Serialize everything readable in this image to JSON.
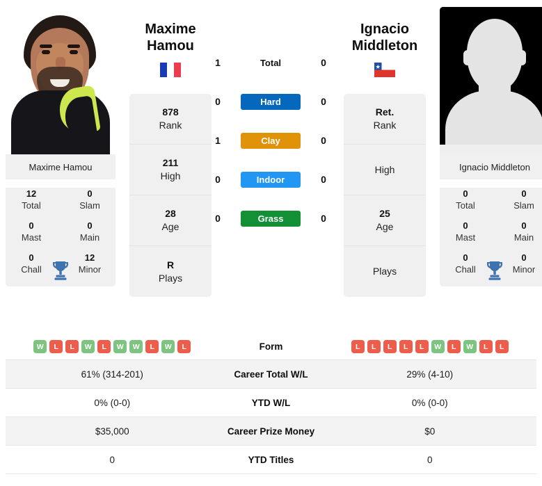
{
  "players": {
    "left": {
      "name_line1": "Maxime",
      "name_line2": "Hamou",
      "full_name": "Maxime Hamou",
      "flag": "france-flag",
      "photo": "player-photo",
      "rank": {
        "value": "878",
        "label": "Rank"
      },
      "high": {
        "value": "211",
        "label": "High"
      },
      "age": {
        "value": "28",
        "label": "Age"
      },
      "plays": {
        "value": "R",
        "label": "Plays"
      },
      "titles": {
        "total": {
          "value": "12",
          "label": "Total"
        },
        "slam": {
          "value": "0",
          "label": "Slam"
        },
        "mast": {
          "value": "0",
          "label": "Mast"
        },
        "main": {
          "value": "0",
          "label": "Main"
        },
        "chall": {
          "value": "0",
          "label": "Chall"
        },
        "minor": {
          "value": "12",
          "label": "Minor"
        }
      },
      "form": [
        "W",
        "L",
        "L",
        "W",
        "L",
        "W",
        "W",
        "L",
        "W",
        "L"
      ],
      "career_total_wl": "61% (314-201)",
      "ytd_wl": "0% (0-0)",
      "career_prize_money": "$35,000",
      "ytd_titles": "0",
      "surface_wins": {
        "total": "1",
        "hard": "0",
        "clay": "1",
        "indoor": "0",
        "grass": "0"
      }
    },
    "right": {
      "name_line1": "Ignacio",
      "name_line2": "Middleton",
      "full_name": "Ignacio Middleton",
      "flag": "chile-flag",
      "photo": "player-photo-placeholder",
      "rank": {
        "value": "Ret.",
        "label": "Rank"
      },
      "high": {
        "value": "",
        "label": "High"
      },
      "age": {
        "value": "25",
        "label": "Age"
      },
      "plays": {
        "value": "",
        "label": "Plays"
      },
      "titles": {
        "total": {
          "value": "0",
          "label": "Total"
        },
        "slam": {
          "value": "0",
          "label": "Slam"
        },
        "mast": {
          "value": "0",
          "label": "Mast"
        },
        "main": {
          "value": "0",
          "label": "Main"
        },
        "chall": {
          "value": "0",
          "label": "Chall"
        },
        "minor": {
          "value": "0",
          "label": "Minor"
        }
      },
      "form": [
        "L",
        "L",
        "L",
        "L",
        "L",
        "W",
        "L",
        "W",
        "L",
        "L"
      ],
      "career_total_wl": "29% (4-10)",
      "ytd_wl": "0% (0-0)",
      "career_prize_money": "$0",
      "ytd_titles": "0",
      "surface_wins": {
        "total": "0",
        "hard": "0",
        "clay": "0",
        "indoor": "0",
        "grass": "0"
      }
    }
  },
  "surfaces": [
    {
      "key": "total",
      "label": "Total",
      "color": "transparent",
      "style": "plain"
    },
    {
      "key": "hard",
      "label": "Hard",
      "color": "#0668bd",
      "style": "pill"
    },
    {
      "key": "clay",
      "label": "Clay",
      "color": "#e09309",
      "style": "pill"
    },
    {
      "key": "indoor",
      "label": "Indoor",
      "color": "#2196f3",
      "style": "pill"
    },
    {
      "key": "grass",
      "label": "Grass",
      "color": "#139036",
      "style": "pill"
    }
  ],
  "stats_rows": [
    {
      "label": "Form",
      "type": "form"
    },
    {
      "label": "Career Total W/L",
      "type": "text",
      "key": "career_total_wl"
    },
    {
      "label": "YTD W/L",
      "type": "text",
      "key": "ytd_wl"
    },
    {
      "label": "Career Prize Money",
      "type": "text",
      "key": "career_prize_money"
    },
    {
      "label": "YTD Titles",
      "type": "text",
      "key": "ytd_titles"
    }
  ],
  "colors": {
    "hard": "#0668bd",
    "clay": "#e09309",
    "indoor": "#2196f3",
    "grass": "#139036",
    "win_badge": "#7cc47f",
    "loss_badge": "#ee5d4c",
    "card_bg": "#f0f0f0",
    "trophy": "#3f72b0"
  }
}
